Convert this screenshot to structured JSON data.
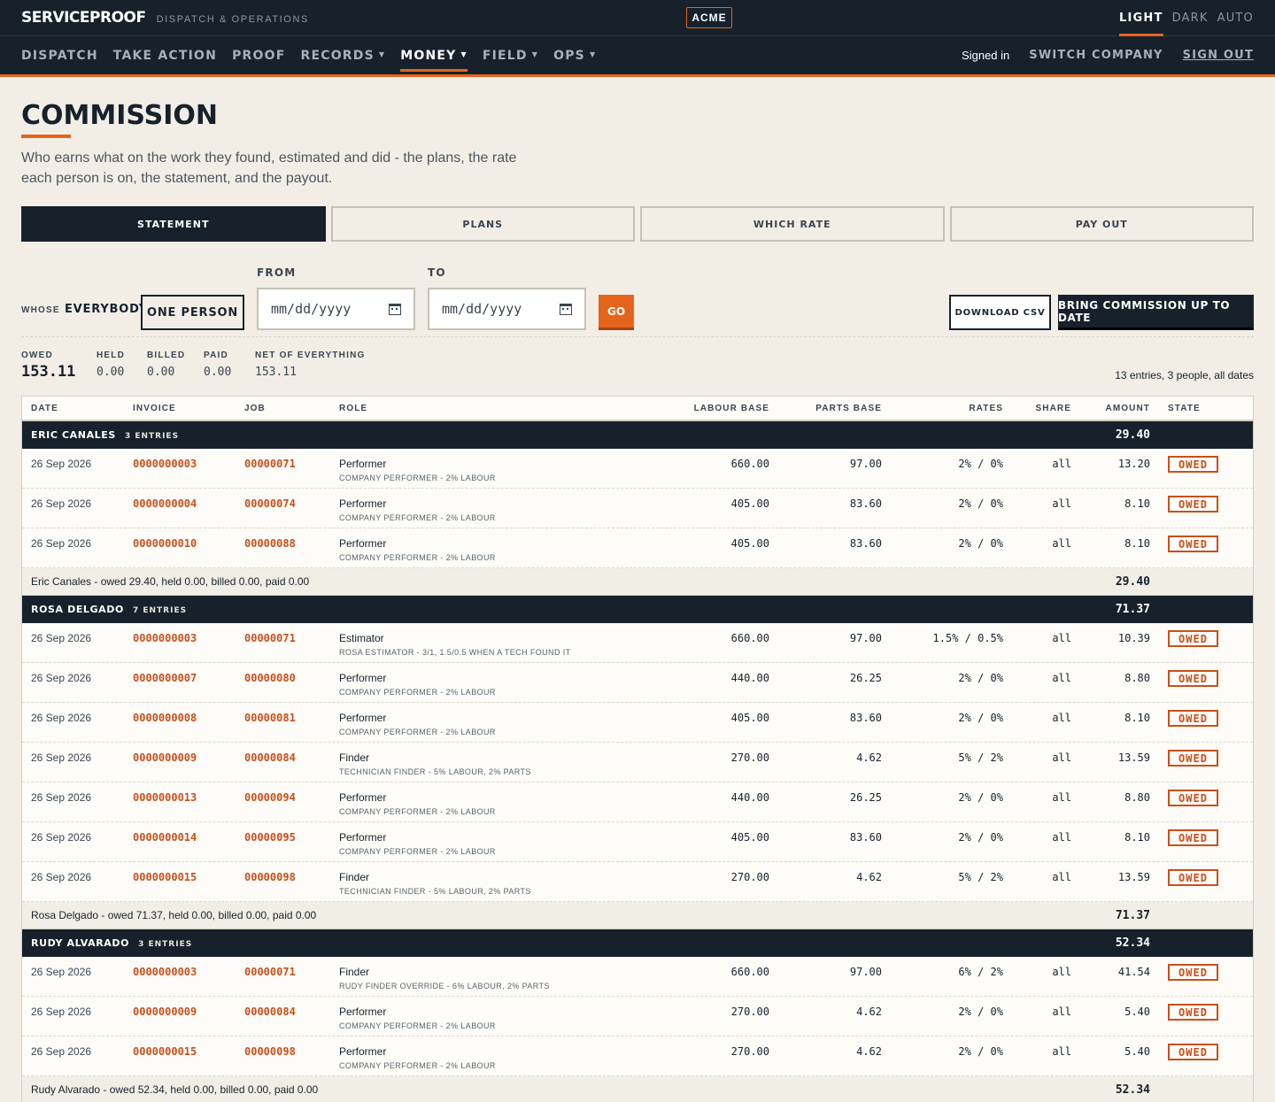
{
  "app": {
    "brand": "SERVICEPROOF",
    "brand_sub": "DISPATCH & OPERATIONS",
    "company": "ACME",
    "theme": [
      "LIGHT",
      "DARK",
      "AUTO"
    ],
    "theme_active": "LIGHT",
    "accent": "#e5641c",
    "navy": "#17212c"
  },
  "nav": {
    "items": [
      {
        "label": "DISPATCH",
        "caret": false
      },
      {
        "label": "TAKE ACTION",
        "caret": false
      },
      {
        "label": "PROOF",
        "caret": false
      },
      {
        "label": "RECORDS",
        "caret": true
      },
      {
        "label": "MONEY",
        "caret": true,
        "active": true
      },
      {
        "label": "FIELD",
        "caret": true
      },
      {
        "label": "OPS",
        "caret": true
      }
    ],
    "signed_in": "Signed in",
    "switch_company": "SWITCH COMPANY",
    "sign_out": "SIGN OUT"
  },
  "page": {
    "title": "COMMISSION",
    "lede": "Who earns what on the work they found, estimated and did - the plans, the rate each person is on, the statement, and the payout.",
    "tabs": [
      "STATEMENT",
      "PLANS",
      "WHICH RATE",
      "PAY OUT"
    ],
    "active_tab": "STATEMENT"
  },
  "filters": {
    "whose_label": "WHOSE",
    "everybody": "EVERYBODY",
    "one_person": "ONE PERSON",
    "from_label": "FROM",
    "to_label": "TO",
    "date_placeholder": "mm/dd/yyyy",
    "go": "GO",
    "download_csv": "DOWNLOAD CSV",
    "bring_up_to_date": "BRING COMMISSION UP TO DATE"
  },
  "totals": {
    "owed": {
      "label": "OWED",
      "value": "153.11"
    },
    "held": {
      "label": "HELD",
      "value": "0.00"
    },
    "billed": {
      "label": "BILLED",
      "value": "0.00"
    },
    "paid": {
      "label": "PAID",
      "value": "0.00"
    },
    "net": {
      "label": "NET OF EVERYTHING",
      "value": "153.11"
    },
    "summary": "13 entries, 3 people, all dates"
  },
  "table": {
    "headers": {
      "date": "DATE",
      "invoice": "INVOICE",
      "job": "JOB",
      "role": "ROLE",
      "labour": "LABOUR BASE",
      "parts": "PARTS BASE",
      "rates": "RATES",
      "share": "SHARE",
      "amount": "AMOUNT",
      "state": "STATE"
    },
    "groups": [
      {
        "name": "ERIC CANALES",
        "count": "3 ENTRIES",
        "total": "29.40",
        "subtotal_text": "Eric Canales - owed 29.40, held 0.00, billed 0.00, paid 0.00",
        "rows": [
          {
            "date": "26 Sep 2026",
            "invoice": "0000000003",
            "job": "00000071",
            "role": "Performer",
            "plan": "Company performer - 2% labour",
            "labour": "660.00",
            "parts": "97.00",
            "rates": "2% / 0%",
            "share": "all",
            "amount": "13.20",
            "state": "OWED"
          },
          {
            "date": "26 Sep 2026",
            "invoice": "0000000004",
            "job": "00000074",
            "role": "Performer",
            "plan": "Company performer - 2% labour",
            "labour": "405.00",
            "parts": "83.60",
            "rates": "2% / 0%",
            "share": "all",
            "amount": "8.10",
            "state": "OWED"
          },
          {
            "date": "26 Sep 2026",
            "invoice": "0000000010",
            "job": "00000088",
            "role": "Performer",
            "plan": "Company performer - 2% labour",
            "labour": "405.00",
            "parts": "83.60",
            "rates": "2% / 0%",
            "share": "all",
            "amount": "8.10",
            "state": "OWED"
          }
        ]
      },
      {
        "name": "ROSA DELGADO",
        "count": "7 ENTRIES",
        "total": "71.37",
        "subtotal_text": "Rosa Delgado - owed 71.37, held 0.00, billed 0.00, paid 0.00",
        "rows": [
          {
            "date": "26 Sep 2026",
            "invoice": "0000000003",
            "job": "00000071",
            "role": "Estimator",
            "plan": "Rosa estimator - 3/1, 1.5/0.5 when a tech found it",
            "labour": "660.00",
            "parts": "97.00",
            "rates": "1.5% / 0.5%",
            "share": "all",
            "amount": "10.39",
            "state": "OWED"
          },
          {
            "date": "26 Sep 2026",
            "invoice": "0000000007",
            "job": "00000080",
            "role": "Performer",
            "plan": "Company performer - 2% labour",
            "labour": "440.00",
            "parts": "26.25",
            "rates": "2% / 0%",
            "share": "all",
            "amount": "8.80",
            "state": "OWED"
          },
          {
            "date": "26 Sep 2026",
            "invoice": "0000000008",
            "job": "00000081",
            "role": "Performer",
            "plan": "Company performer - 2% labour",
            "labour": "405.00",
            "parts": "83.60",
            "rates": "2% / 0%",
            "share": "all",
            "amount": "8.10",
            "state": "OWED"
          },
          {
            "date": "26 Sep 2026",
            "invoice": "0000000009",
            "job": "00000084",
            "role": "Finder",
            "plan": "Technician finder - 5% labour, 2% parts",
            "labour": "270.00",
            "parts": "4.62",
            "rates": "5% / 2%",
            "share": "all",
            "amount": "13.59",
            "state": "OWED"
          },
          {
            "date": "26 Sep 2026",
            "invoice": "0000000013",
            "job": "00000094",
            "role": "Performer",
            "plan": "Company performer - 2% labour",
            "labour": "440.00",
            "parts": "26.25",
            "rates": "2% / 0%",
            "share": "all",
            "amount": "8.80",
            "state": "OWED"
          },
          {
            "date": "26 Sep 2026",
            "invoice": "0000000014",
            "job": "00000095",
            "role": "Performer",
            "plan": "Company performer - 2% labour",
            "labour": "405.00",
            "parts": "83.60",
            "rates": "2% / 0%",
            "share": "all",
            "amount": "8.10",
            "state": "OWED"
          },
          {
            "date": "26 Sep 2026",
            "invoice": "0000000015",
            "job": "00000098",
            "role": "Finder",
            "plan": "Technician finder - 5% labour, 2% parts",
            "labour": "270.00",
            "parts": "4.62",
            "rates": "5% / 2%",
            "share": "all",
            "amount": "13.59",
            "state": "OWED"
          }
        ]
      },
      {
        "name": "RUDY ALVARADO",
        "count": "3 ENTRIES",
        "total": "52.34",
        "subtotal_text": "Rudy Alvarado - owed 52.34, held 0.00, billed 0.00, paid 0.00",
        "rows": [
          {
            "date": "26 Sep 2026",
            "invoice": "0000000003",
            "job": "00000071",
            "role": "Finder",
            "plan": "Rudy finder override - 6% labour, 2% parts",
            "labour": "660.00",
            "parts": "97.00",
            "rates": "6% / 2%",
            "share": "all",
            "amount": "41.54",
            "state": "OWED"
          },
          {
            "date": "26 Sep 2026",
            "invoice": "0000000009",
            "job": "00000084",
            "role": "Performer",
            "plan": "Company performer - 2% labour",
            "labour": "270.00",
            "parts": "4.62",
            "rates": "2% / 0%",
            "share": "all",
            "amount": "5.40",
            "state": "OWED"
          },
          {
            "date": "26 Sep 2026",
            "invoice": "0000000015",
            "job": "00000098",
            "role": "Performer",
            "plan": "Company performer - 2% labour",
            "labour": "270.00",
            "parts": "4.62",
            "rates": "2% / 0%",
            "share": "all",
            "amount": "5.40",
            "state": "OWED"
          }
        ]
      }
    ]
  }
}
